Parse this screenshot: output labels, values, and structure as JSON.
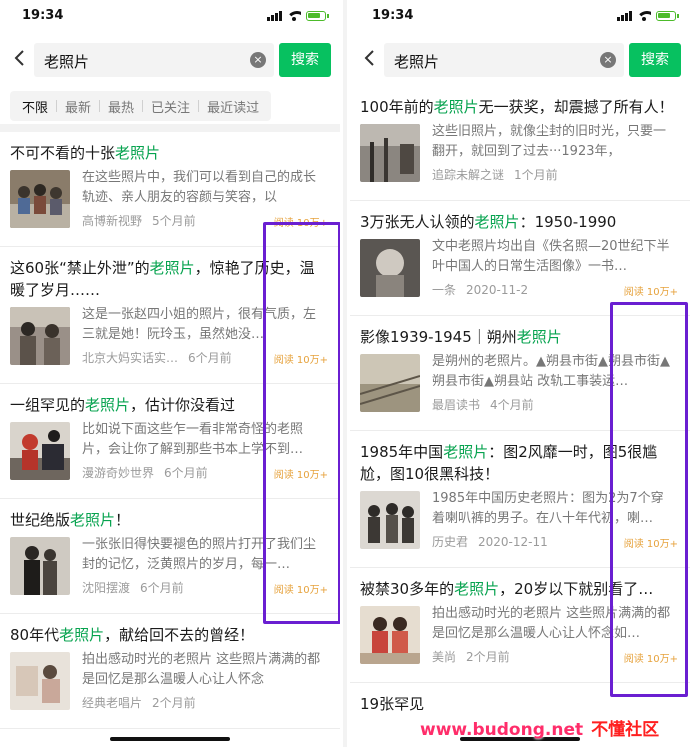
{
  "left": {
    "status_time": "19:34",
    "search_value": "老照片",
    "search_button": "搜索",
    "filters": [
      "不限",
      "最新",
      "最热",
      "已关注",
      "最近读过"
    ],
    "articles": [
      {
        "title_pre": "不可不看的十张",
        "title_hl": "老照片",
        "title_post": "",
        "desc": "在这些照片中，我们可以看到自己的成长轨迹、亲人朋友的容颜与笑容，以",
        "source": "高博新视野",
        "time": "5个月前",
        "reads": "阅读 10万+"
      },
      {
        "title_pre": "这60张“禁止外泄”的",
        "title_hl": "老照片",
        "title_post": "，惊艳了历史，温暖了岁月……",
        "desc": "这是一张赵四小姐的照片，很有气质，左三就是她！阮玲玉，虽然她没…",
        "source": "北京大妈实话实…",
        "time": "6个月前",
        "reads": "阅读 10万+"
      },
      {
        "title_pre": "一组罕见的",
        "title_hl": "老照片",
        "title_post": "，估计你没看过",
        "desc": "比如说下面这些乍一看非常奇怪的老照片，会让你了解到那些书本上学不到…",
        "source": "漫游奇妙世界",
        "time": "6个月前",
        "reads": "阅读 10万+"
      },
      {
        "title_pre": "世纪绝版",
        "title_hl": "老照片",
        "title_post": "！",
        "desc": "一张张旧得快要褪色的照片打开了我们尘封的记忆，泛黄照片的岁月，每一…",
        "source": "沈阳摆渡",
        "time": "6个月前",
        "reads": "阅读 10万+"
      },
      {
        "title_pre": "80年代",
        "title_hl": "老照片",
        "title_post": "，献给回不去的曾经！",
        "desc": "拍出感动时光的老照片 这些照片满满的都是回忆是那么温暖人心让人怀念",
        "source": "经典老唱片",
        "time": "2个月前",
        "reads": ""
      }
    ]
  },
  "right": {
    "status_time": "19:34",
    "search_value": "老照片",
    "search_button": "搜索",
    "articles": [
      {
        "title_pre": "100年前的",
        "title_hl": "老照片",
        "title_post": "无一获奖，却震撼了所有人！",
        "desc": "这些旧照片，就像尘封的旧时光，只要一翻开，就回到了过去···1923年，",
        "source": "追踪未解之谜",
        "time": "1个月前",
        "reads": ""
      },
      {
        "title_pre": "3万张无人认领的",
        "title_hl": "老照片",
        "title_post": "：1950-1990",
        "desc": "文中老照片均出自《佚名照—20世纪下半叶中国人的日常生活图像》一书…",
        "source": "一条",
        "time": "2020-11-2",
        "reads": "阅读 10万+"
      },
      {
        "title_pre": "影像1939-1945｜朔州",
        "title_hl": "老照片",
        "title_post": "",
        "desc": "是朔州的老照片。▲朔县市街▲朔县市街▲朔县市街▲朔县站 改轨工事装运…",
        "source": "最眉读书",
        "time": "4个月前",
        "reads": ""
      },
      {
        "title_pre": "1985年中国",
        "title_hl": "老照片",
        "title_post": "：图2风靡一时，图5很尴尬，图10很黑科技！",
        "desc": "1985年中国历史老照片：图为2为7个穿着喇叭裤的男子。在八十年代初，喇…",
        "source": "历史君",
        "time": "2020-12-11",
        "reads": "阅读 10万+"
      },
      {
        "title_pre": "被禁30多年的",
        "title_hl": "老照片",
        "title_post": "，20岁以下就别看了…",
        "desc": "拍出感动时光的老照片 这些照片满满的都是回忆是那么温暖人心让人怀念如…",
        "source": "美尚",
        "time": "2个月前",
        "reads": "阅读 10万+"
      },
      {
        "title_pre": "19张罕见",
        "title_hl": "",
        "title_post": "",
        "desc": "",
        "source": "",
        "time": "",
        "reads": ""
      }
    ]
  },
  "watermark": {
    "site": "www.budong.net",
    "name": "不懂社区"
  },
  "colors": {
    "accent": "#07c160",
    "highlight_text": "#07a34f",
    "reads": "#e6a23c",
    "annotation_box": "#6a1fd1"
  }
}
